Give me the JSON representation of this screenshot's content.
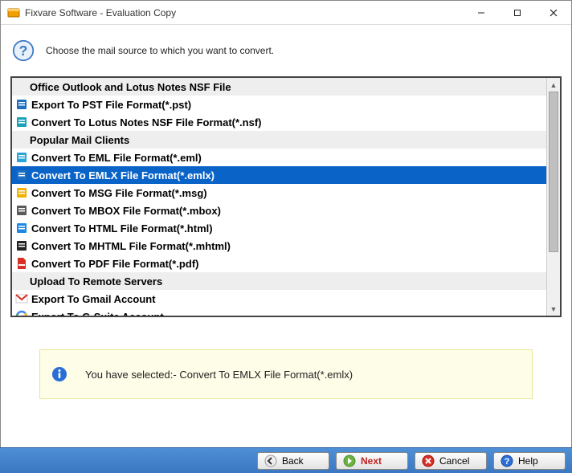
{
  "window": {
    "title": "Fixvare Software - Evaluation Copy"
  },
  "instruction": "Choose the mail source to which you want to convert.",
  "sections": [
    {
      "header": "Office Outlook and Lotus Notes NSF File",
      "items": [
        {
          "icon": "pst",
          "label": "Export To PST File Format(*.pst)",
          "selected": false
        },
        {
          "icon": "nsf",
          "label": "Convert To Lotus Notes NSF File Format(*.nsf)",
          "selected": false
        }
      ]
    },
    {
      "header": "Popular Mail Clients",
      "items": [
        {
          "icon": "eml",
          "label": "Convert To EML File Format(*.eml)",
          "selected": false
        },
        {
          "icon": "emlx",
          "label": "Convert To EMLX File Format(*.emlx)",
          "selected": true
        },
        {
          "icon": "msg",
          "label": "Convert To MSG File Format(*.msg)",
          "selected": false
        },
        {
          "icon": "mbox",
          "label": "Convert To MBOX File Format(*.mbox)",
          "selected": false
        },
        {
          "icon": "html",
          "label": "Convert To HTML File Format(*.html)",
          "selected": false
        },
        {
          "icon": "mhtml",
          "label": "Convert To MHTML File Format(*.mhtml)",
          "selected": false
        },
        {
          "icon": "pdf",
          "label": "Convert To PDF File Format(*.pdf)",
          "selected": false
        }
      ]
    },
    {
      "header": "Upload To Remote Servers",
      "items": [
        {
          "icon": "gmail",
          "label": "Export To Gmail Account",
          "selected": false
        },
        {
          "icon": "gsuite",
          "label": "Export To G-Suite Account",
          "selected": false
        }
      ]
    }
  ],
  "info": {
    "prefix": "You have selected:- ",
    "selection": "Convert To EMLX File Format(*.emlx)"
  },
  "buttons": {
    "back": "Back",
    "next": "Next",
    "cancel": "Cancel",
    "help": "Help"
  },
  "icon_colors": {
    "pst": "#1e6fbf",
    "nsf": "#1aa3b8",
    "eml": "#2aa5d8",
    "emlx": "#1e6fbf",
    "msg": "#f2b200",
    "mbox": "#5a5a5a",
    "html": "#1e88e5",
    "mhtml": "#222",
    "pdf": "#d93025",
    "gmail": "#d93025",
    "gsuite": "#4285f4"
  }
}
